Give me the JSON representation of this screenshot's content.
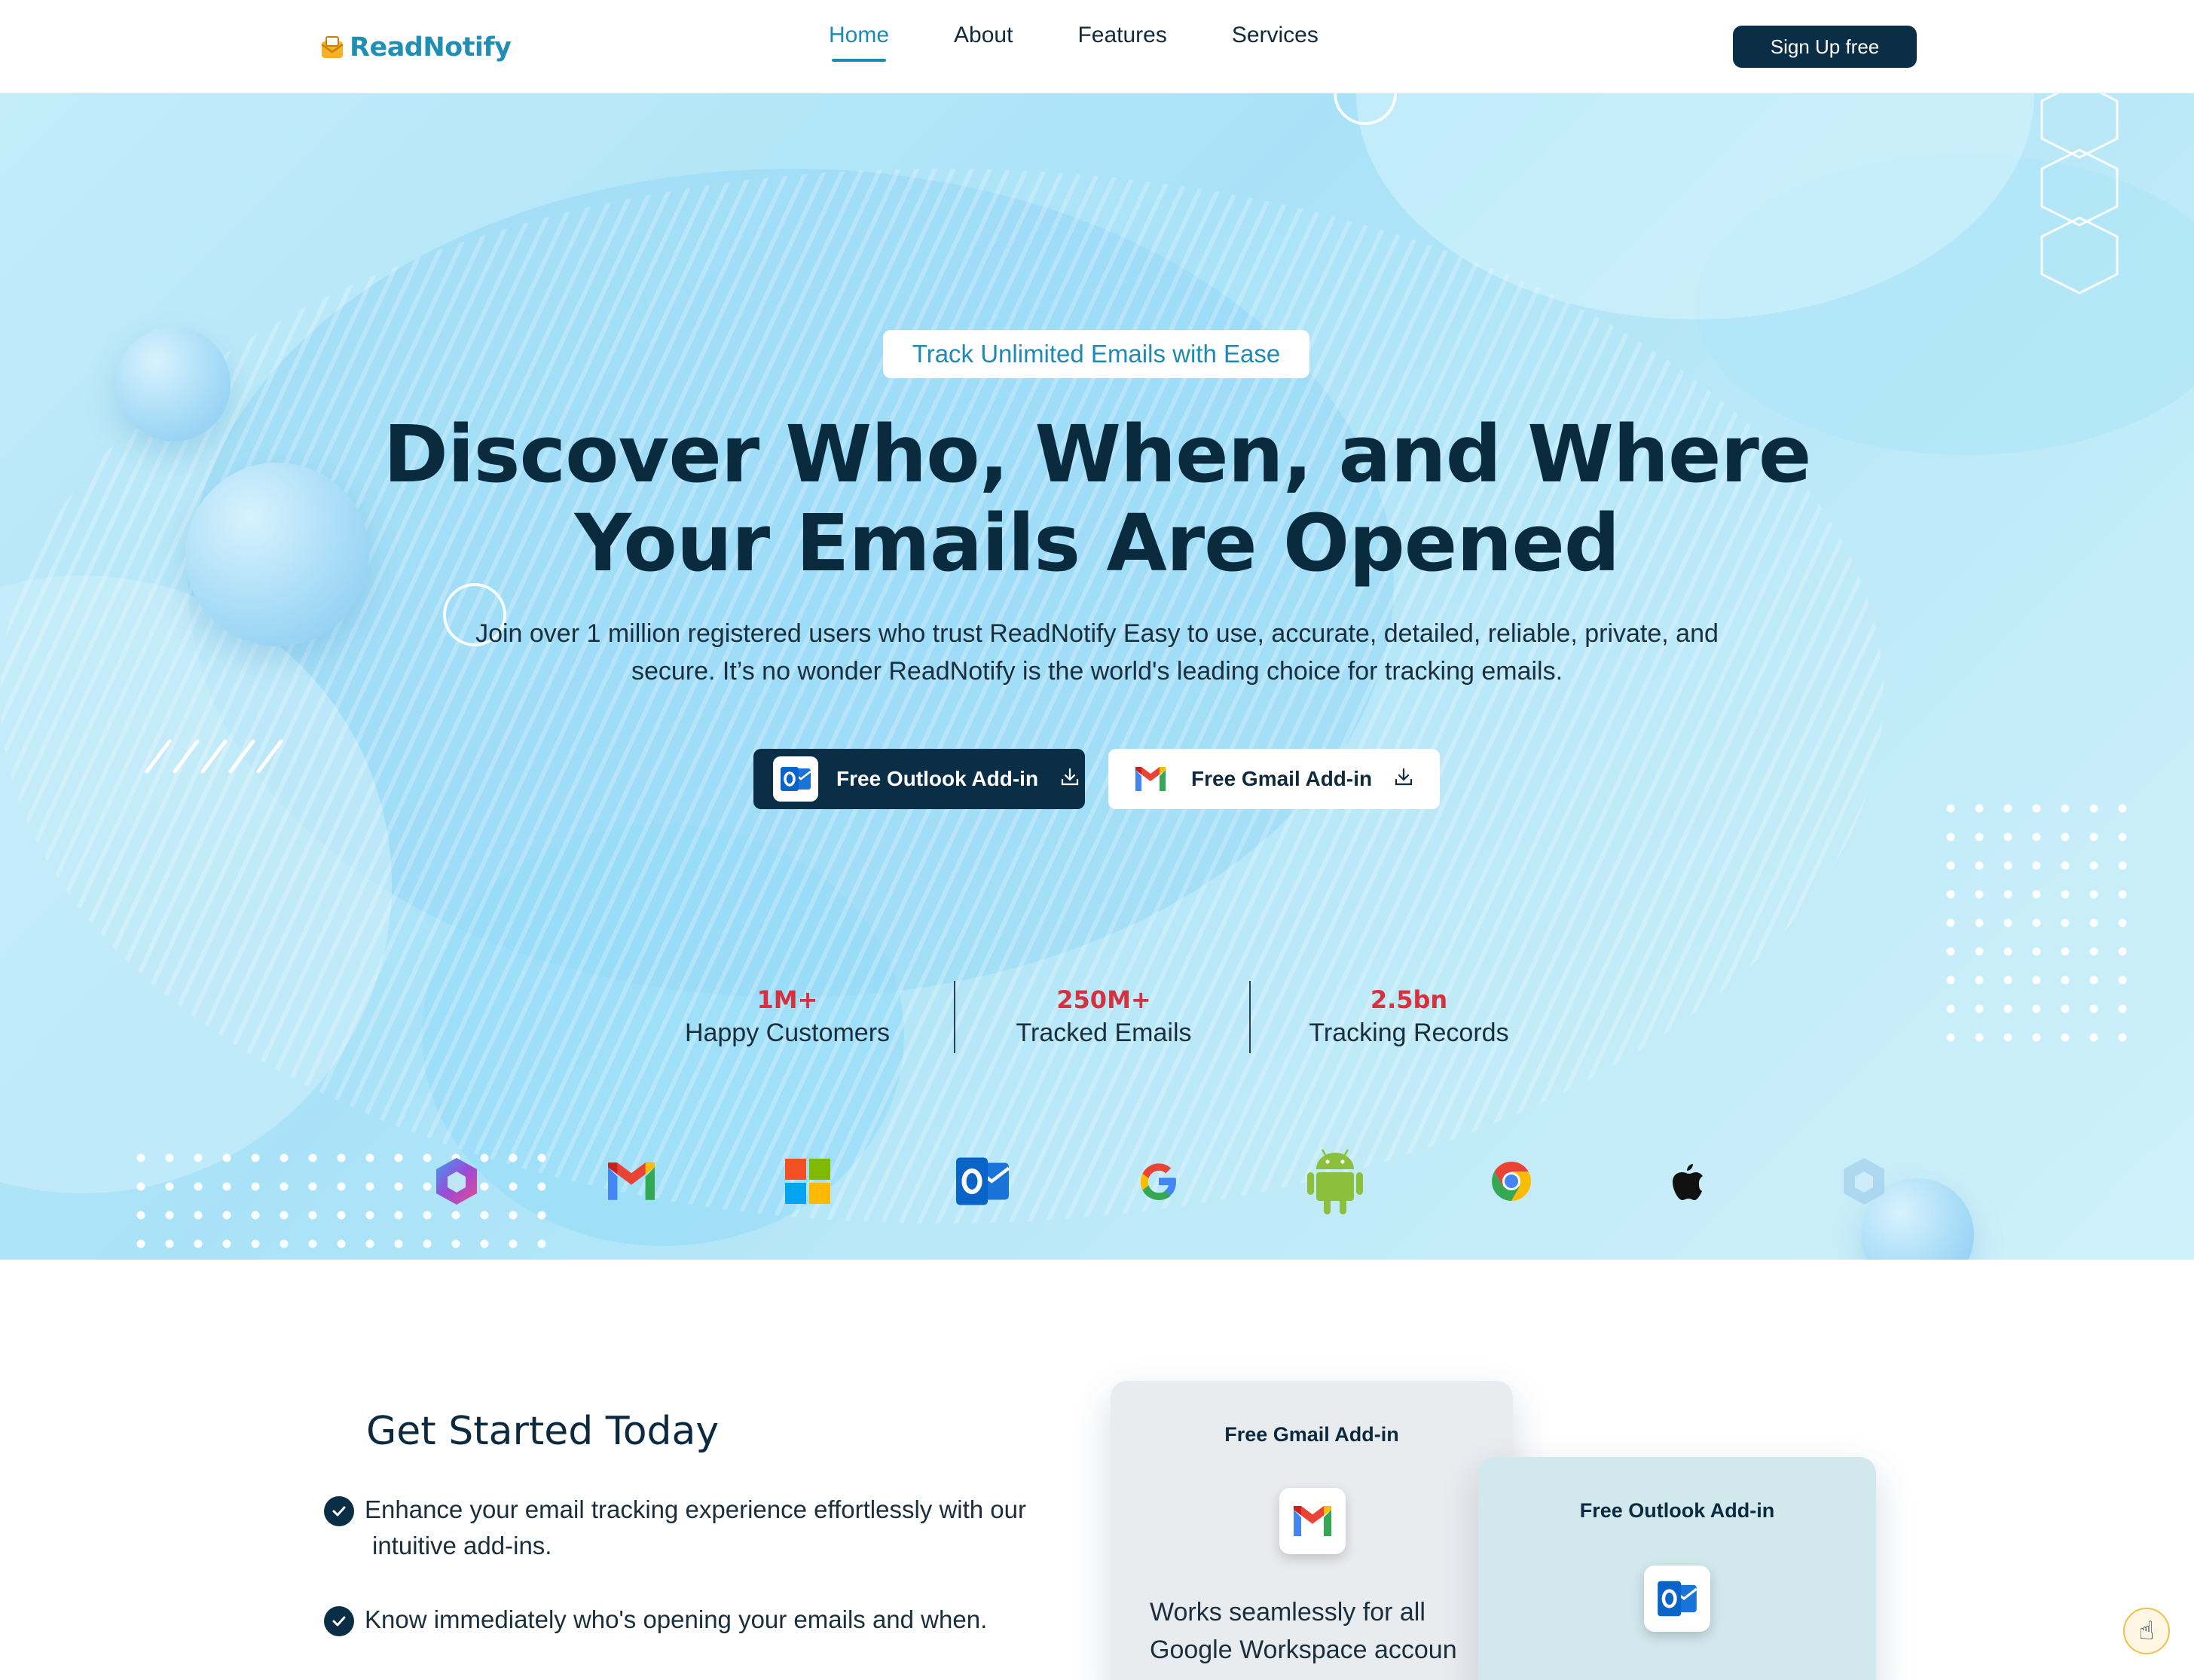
{
  "header": {
    "logo_text": "ReadNotify",
    "nav": [
      {
        "label": "Home",
        "active": true
      },
      {
        "label": "About",
        "active": false
      },
      {
        "label": "Features",
        "active": false
      },
      {
        "label": "Services",
        "active": false
      }
    ],
    "signup_label": "Sign Up free"
  },
  "hero": {
    "tag": "Track Unlimited Emails with Ease",
    "title_line1": "Discover Who, When, and Where",
    "title_line2": "Your Emails Are Opened",
    "subtitle_line1": "Join over 1 million registered users who trust ReadNotify Easy to use, accurate, detailed, reliable, private, and",
    "subtitle_line2": "secure. It’s no wonder ReadNotify is the world's leading choice for tracking emails.",
    "cta_outlook": "Free Outlook Add-in",
    "cta_gmail": "Free Gmail Add-in"
  },
  "stats": [
    {
      "value": "1M+",
      "label": "Happy Customers"
    },
    {
      "value": "250M+",
      "label": "Tracked Emails"
    },
    {
      "value": "2.5bn",
      "label": "Tracking Records"
    }
  ],
  "brands": [
    "microsoft-365-icon",
    "gmail-icon",
    "windows-icon",
    "outlook-icon",
    "google-icon",
    "android-icon",
    "chrome-icon",
    "apple-icon",
    "microsoft-365-icon"
  ],
  "get_started": {
    "title": "Get Started Today",
    "items": [
      "Enhance your email tracking experience effortlessly with our intuitive add-ins.",
      "Know immediately who's opening your emails and when."
    ]
  },
  "cards": {
    "gmail_title": "Free Gmail Add-in",
    "gmail_desc_line1": "Works seamlessly for all",
    "gmail_desc_line2": "Google Workspace accoun",
    "outlook_title": "Free Outlook Add-in"
  },
  "colors": {
    "brand_dark": "#0a2e45",
    "accent_blue": "#1e8ab3",
    "stat_red": "#d6313f"
  }
}
